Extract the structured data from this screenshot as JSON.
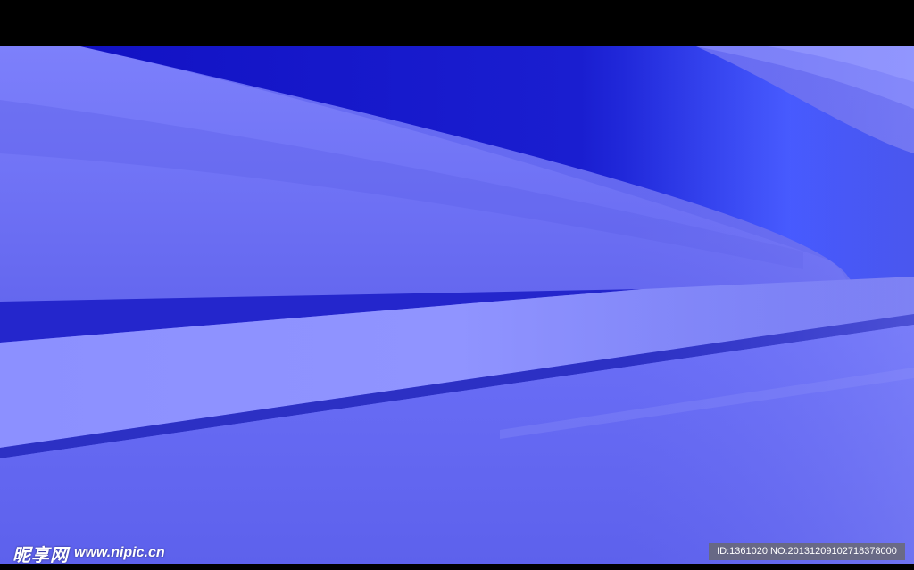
{
  "watermark": {
    "logo_text": "昵享网",
    "site_text": "www.nipic.cn",
    "id_text": "ID:1361020 NO:20131209102718378000"
  },
  "colors": {
    "base": "#6a6ef4",
    "dark_band": "#1a1ad0",
    "light_band": "#8a8eff",
    "thin_stripe": "#2a2fc2",
    "letterbox": "#000000"
  }
}
